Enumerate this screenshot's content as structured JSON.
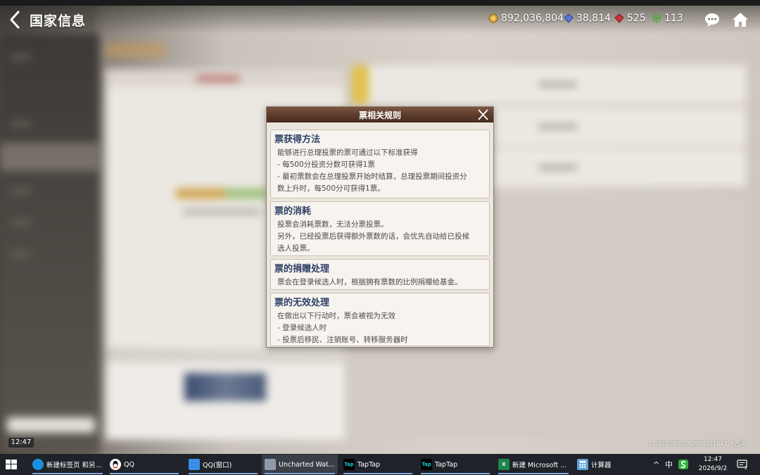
{
  "app": {
    "title": "国家信息",
    "resources": [
      {
        "name": "gold",
        "value": "892,036,804",
        "color": "#d9a43a"
      },
      {
        "name": "gem",
        "value": "38,814",
        "color": "#5a74d8"
      },
      {
        "name": "ruby",
        "value": "525",
        "color": "#c8343a"
      },
      {
        "name": "gear",
        "value": "113",
        "color": "#4fa83a"
      }
    ],
    "clock_chip": "12:47",
    "version": "1.0303.081.22 2608271847 大西洋"
  },
  "modal": {
    "title": "票相关规则",
    "sections": [
      {
        "title": "票获得方法",
        "lines": [
          "能够进行总理投票的票可通过以下标准获得",
          "- 每500分投资分数可获得1票",
          "- 最初票数会在总理投票开始时结算，总理投票期间投资分",
          "数上升时，每500分可获得1票。"
        ]
      },
      {
        "title": "票的消耗",
        "lines": [
          "投票会消耗票数，无法分票投票。",
          "另外，已经投票后获得额外票数的话，会优先自动给已投候",
          "选人投票。"
        ]
      },
      {
        "title": "票的捐赠处理",
        "lines": [
          "票会在登录候选人时，根据拥有票数的比例捐赠给基金。"
        ]
      },
      {
        "title": "票的无效处理",
        "lines": [
          "在做出以下行动时，票会被视为无效",
          "- 登录候选人时",
          "- 投票后移民、注销账号、转移服务器时"
        ]
      }
    ]
  },
  "taskbar": {
    "items": [
      {
        "label": "新建标签页 和另...",
        "icon": "edge-icon",
        "color": "#1a8fe0"
      },
      {
        "label": "QQ",
        "icon": "qq-icon",
        "color": "#ffffff"
      },
      {
        "label": "QQ(窗口)",
        "icon": "qq-window-icon",
        "color": "#3a8ee6"
      },
      {
        "label": "Uncharted Wat...",
        "icon": "game-icon",
        "color": "#8f9aa8"
      },
      {
        "label": "TapTap",
        "icon": "taptap-icon",
        "color": "#17c5ce",
        "icon_text": "Tap"
      },
      {
        "label": "TapTap",
        "icon": "taptap-icon",
        "color": "#17c5ce",
        "icon_text": "Tap"
      },
      {
        "label": "新建 Microsoft ...",
        "icon": "excel-icon",
        "color": "#1e8449"
      },
      {
        "label": "计算器",
        "icon": "calculator-icon",
        "color": "#5a9fd6"
      }
    ],
    "tray": {
      "chevron": "^",
      "ime": "中",
      "clock_time": "12:47",
      "clock_date": "2026/9/2",
      "notification_count": "2"
    }
  }
}
